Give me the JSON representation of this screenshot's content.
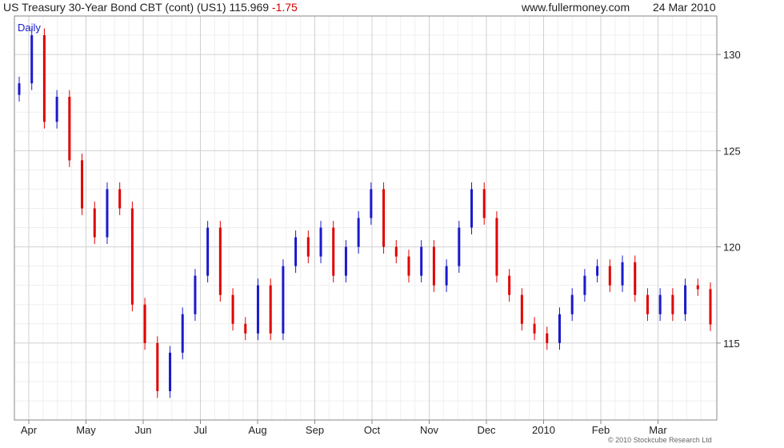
{
  "header": {
    "instrument": "US Treasury 30-Year  Bond CBT (cont) (US1)",
    "price": "115.969",
    "change": "-1.75",
    "website": "www.fullermoney.com",
    "date": "24 Mar 2010"
  },
  "period_label": "Daily",
  "copyright": "© 2010 Stockcube Research Ltd",
  "colors": {
    "up": "#1a1acc",
    "down": "#e00000",
    "grid": "#d0d0d0",
    "frame": "#888888",
    "period": "#1a1acc"
  },
  "chart_data": {
    "type": "candlestick",
    "title": "US Treasury 30-Year  Bond CBT (cont) (US1)",
    "x_axis": {
      "labels": [
        "Apr",
        "May",
        "Jun",
        "Jul",
        "Aug",
        "Sep",
        "Oct",
        "Nov",
        "Dec",
        "2010",
        "Feb",
        "Mar"
      ]
    },
    "y_axis": {
      "min": 111,
      "max": 132,
      "ticks": [
        115,
        120,
        125,
        130
      ],
      "side": "right"
    },
    "grid": true,
    "series": [
      {
        "date": "Apr",
        "close": 128.5,
        "direction": "up"
      },
      {
        "date": "Apr",
        "close": 131.0,
        "direction": "up"
      },
      {
        "date": "Apr",
        "close": 126.5,
        "direction": "down"
      },
      {
        "date": "Apr",
        "close": 127.8,
        "direction": "up"
      },
      {
        "date": "May",
        "close": 124.5,
        "direction": "down"
      },
      {
        "date": "May",
        "close": 122.0,
        "direction": "down"
      },
      {
        "date": "May",
        "close": 120.5,
        "direction": "down"
      },
      {
        "date": "May",
        "close": 123.0,
        "direction": "up"
      },
      {
        "date": "May",
        "close": 122.0,
        "direction": "down"
      },
      {
        "date": "Jun",
        "close": 117.0,
        "direction": "down"
      },
      {
        "date": "Jun",
        "close": 115.0,
        "direction": "down"
      },
      {
        "date": "Jun",
        "close": 112.5,
        "direction": "down"
      },
      {
        "date": "Jun",
        "close": 114.5,
        "direction": "up"
      },
      {
        "date": "Jun",
        "close": 116.5,
        "direction": "up"
      },
      {
        "date": "Jul",
        "close": 118.5,
        "direction": "up"
      },
      {
        "date": "Jul",
        "close": 121.0,
        "direction": "up"
      },
      {
        "date": "Jul",
        "close": 117.5,
        "direction": "down"
      },
      {
        "date": "Jul",
        "close": 116.0,
        "direction": "down"
      },
      {
        "date": "Aug",
        "close": 115.5,
        "direction": "down"
      },
      {
        "date": "Aug",
        "close": 118.0,
        "direction": "up"
      },
      {
        "date": "Aug",
        "close": 115.5,
        "direction": "down"
      },
      {
        "date": "Aug",
        "close": 119.0,
        "direction": "up"
      },
      {
        "date": "Sep",
        "close": 120.5,
        "direction": "up"
      },
      {
        "date": "Sep",
        "close": 119.5,
        "direction": "down"
      },
      {
        "date": "Sep",
        "close": 121.0,
        "direction": "up"
      },
      {
        "date": "Sep",
        "close": 118.5,
        "direction": "down"
      },
      {
        "date": "Oct",
        "close": 120.0,
        "direction": "up"
      },
      {
        "date": "Oct",
        "close": 121.5,
        "direction": "up"
      },
      {
        "date": "Oct",
        "close": 123.0,
        "direction": "up"
      },
      {
        "date": "Oct",
        "close": 120.0,
        "direction": "down"
      },
      {
        "date": "Nov",
        "close": 119.5,
        "direction": "down"
      },
      {
        "date": "Nov",
        "close": 118.5,
        "direction": "down"
      },
      {
        "date": "Nov",
        "close": 120.0,
        "direction": "up"
      },
      {
        "date": "Nov",
        "close": 118.0,
        "direction": "down"
      },
      {
        "date": "Nov",
        "close": 119.0,
        "direction": "up"
      },
      {
        "date": "Nov",
        "close": 121.0,
        "direction": "up"
      },
      {
        "date": "Dec",
        "close": 123.0,
        "direction": "up"
      },
      {
        "date": "Dec",
        "close": 121.5,
        "direction": "down"
      },
      {
        "date": "Dec",
        "close": 118.5,
        "direction": "down"
      },
      {
        "date": "Dec",
        "close": 117.5,
        "direction": "down"
      },
      {
        "date": "Dec",
        "close": 116.0,
        "direction": "down"
      },
      {
        "date": "2010",
        "close": 115.5,
        "direction": "down"
      },
      {
        "date": "2010",
        "close": 115.0,
        "direction": "down"
      },
      {
        "date": "2010",
        "close": 116.5,
        "direction": "up"
      },
      {
        "date": "2010",
        "close": 117.5,
        "direction": "up"
      },
      {
        "date": "2010",
        "close": 118.5,
        "direction": "up"
      },
      {
        "date": "Feb",
        "close": 119.0,
        "direction": "up"
      },
      {
        "date": "Feb",
        "close": 118.0,
        "direction": "down"
      },
      {
        "date": "Feb",
        "close": 119.2,
        "direction": "up"
      },
      {
        "date": "Feb",
        "close": 117.5,
        "direction": "down"
      },
      {
        "date": "Mar",
        "close": 116.5,
        "direction": "down"
      },
      {
        "date": "Mar",
        "close": 117.5,
        "direction": "up"
      },
      {
        "date": "Mar",
        "close": 116.5,
        "direction": "down"
      },
      {
        "date": "Mar",
        "close": 118.0,
        "direction": "up"
      },
      {
        "date": "Mar",
        "close": 117.8,
        "direction": "down"
      },
      {
        "date": "Mar",
        "close": 115.969,
        "direction": "down"
      }
    ]
  }
}
